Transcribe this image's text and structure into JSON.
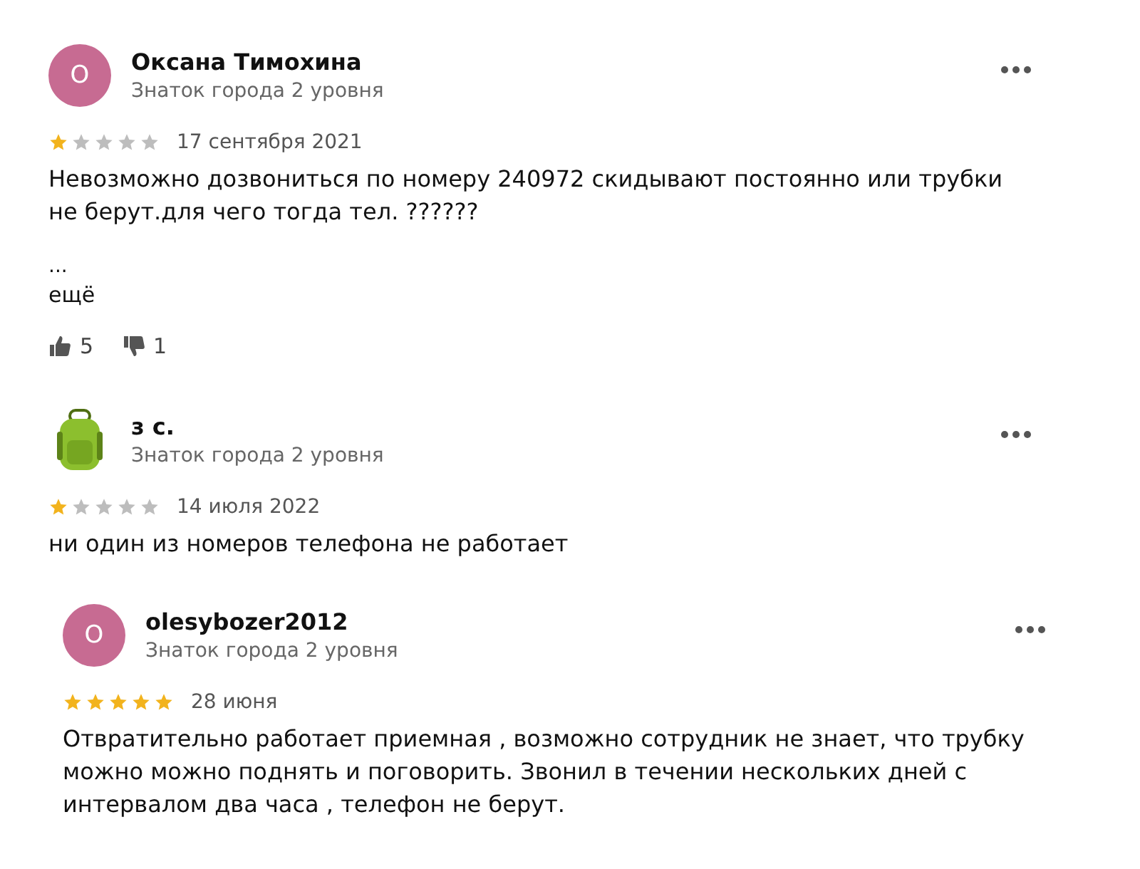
{
  "reviews": [
    {
      "avatar": {
        "kind": "letter",
        "letter": "O"
      },
      "name": "Оксана Тимохина",
      "level": "Знаток города 2 уровня",
      "stars": 1,
      "date": "17 сентября 2021",
      "text": "Невозможно дозвониться по номеру 240972 скидывают постоянно или трубки не берут.для чего тогда тел. ??????",
      "ellipsis": "...",
      "more": "ещё",
      "likes": "5",
      "dislikes": "1"
    },
    {
      "avatar": {
        "kind": "backpack"
      },
      "name": "з с.",
      "level": "Знаток города 2 уровня",
      "stars": 1,
      "date": "14 июля 2022",
      "text": "ни один из номеров телефона не работает"
    },
    {
      "avatar": {
        "kind": "letter",
        "letter": "O"
      },
      "name": "olesybozer2012",
      "level": "Знаток города 2 уровня",
      "stars": 5,
      "date": "28 июня",
      "text": "Отвратительно работает приемная , возможно сотрудник не знает, что трубку можно можно поднять и поговорить. Звонил в течении нескольких дней с интервалом два часа , телефон не берут."
    }
  ]
}
